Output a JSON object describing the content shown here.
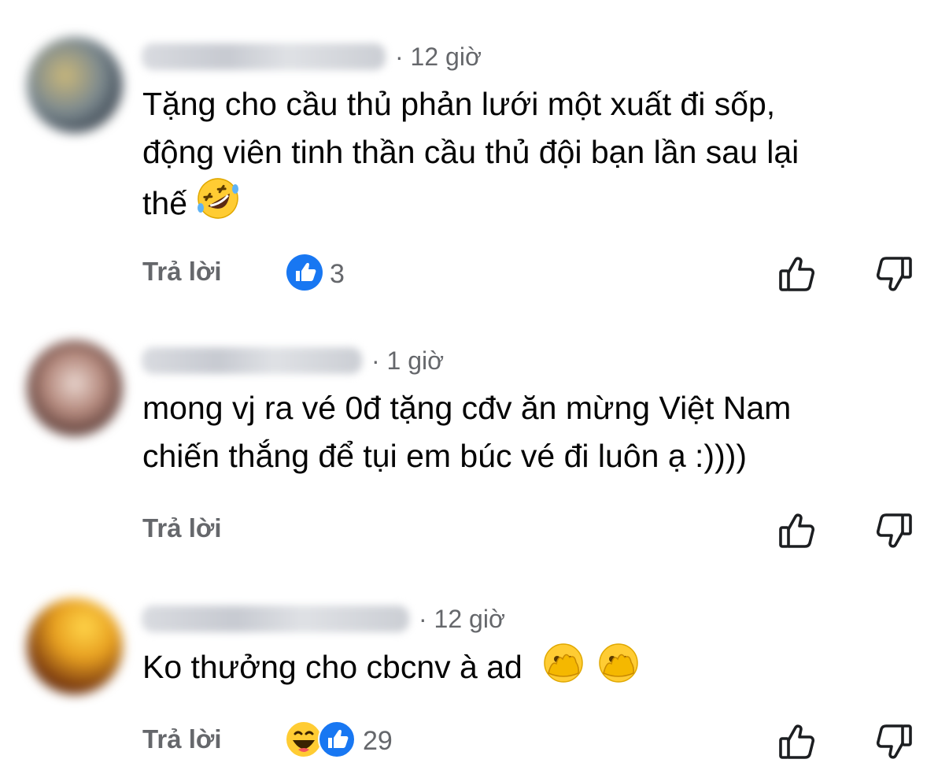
{
  "comments": [
    {
      "time": "· 12 giờ",
      "lines": [
        "Tặng cho cầu thủ phản lưới một xuất đi sốp,",
        "động viên tinh thần cầu thủ đội bạn lần sau lại",
        "thế"
      ],
      "emoji": [
        "rolling-on-floor-laughing"
      ],
      "reply": "Trả lời",
      "reaction_icons": [
        "like"
      ],
      "reaction_count": "3"
    },
    {
      "time": "· 1 giờ",
      "lines": [
        "mong vj ra vé 0đ tặng cđv ăn mừng Việt Nam",
        "chiến thắng để tụi em búc vé đi luôn ạ :))))"
      ],
      "emoji": [],
      "reply": "Trả lời",
      "reaction_icons": [],
      "reaction_count": ""
    },
    {
      "time": "· 12 giờ",
      "lines": [
        "Ko thưởng cho cbcnv à ad"
      ],
      "emoji": [
        "face-with-open-eyes-and-hand-over-mouth",
        "face-with-open-eyes-and-hand-over-mouth"
      ],
      "reply": "Trả lời",
      "reaction_icons": [
        "haha",
        "like"
      ],
      "reaction_count": "29"
    }
  ],
  "colors": {
    "meta_gray": "#65676b",
    "text": "#050505",
    "like_blue": "#1877f2",
    "emoji_yellow": "#ffcc33"
  }
}
